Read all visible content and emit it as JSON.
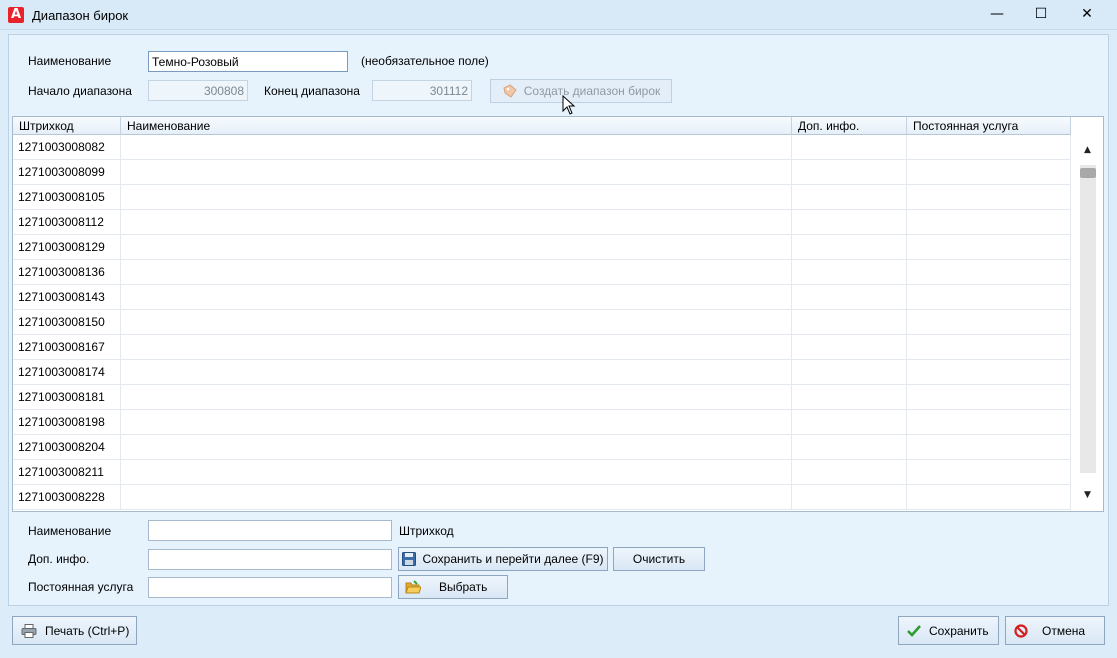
{
  "window": {
    "title": "Диапазон бирок",
    "logo_letter": "A",
    "minimize": "—",
    "maximize": "☐",
    "close": "✕"
  },
  "header_form": {
    "name_label": "Наименование",
    "name_value": "Темно-Розовый",
    "optional_hint": "(необязательное поле)",
    "range_start_label": "Начало диапазона",
    "range_start_value": "300808",
    "range_end_label": "Конец диапазона",
    "range_end_value": "301112",
    "create_range_label": "Создать диапазон бирок"
  },
  "grid": {
    "columns": [
      "Штрихкод",
      "Наименование",
      "Доп. инфо.",
      "Постоянная услуга"
    ],
    "rows": [
      [
        "1271003008082",
        "",
        "",
        ""
      ],
      [
        "1271003008099",
        "",
        "",
        ""
      ],
      [
        "1271003008105",
        "",
        "",
        ""
      ],
      [
        "1271003008112",
        "",
        "",
        ""
      ],
      [
        "1271003008129",
        "",
        "",
        ""
      ],
      [
        "1271003008136",
        "",
        "",
        ""
      ],
      [
        "1271003008143",
        "",
        "",
        ""
      ],
      [
        "1271003008150",
        "",
        "",
        ""
      ],
      [
        "1271003008167",
        "",
        "",
        ""
      ],
      [
        "1271003008174",
        "",
        "",
        ""
      ],
      [
        "1271003008181",
        "",
        "",
        ""
      ],
      [
        "1271003008198",
        "",
        "",
        ""
      ],
      [
        "1271003008204",
        "",
        "",
        ""
      ],
      [
        "1271003008211",
        "",
        "",
        ""
      ],
      [
        "1271003008228",
        "",
        "",
        ""
      ]
    ],
    "scroll_up": "▲",
    "scroll_down": "▼"
  },
  "edit_form": {
    "name_label": "Наименование",
    "name_value": "",
    "barcode_label": "Штрихкод",
    "info_label": "Доп. инфо.",
    "info_value": "",
    "service_label": "Постоянная услуга",
    "service_value": "",
    "save_next_label": "Сохранить и перейти далее (F9)",
    "clear_label": "Очистить",
    "select_label": "Выбрать"
  },
  "footer": {
    "print_label": "Печать (Ctrl+P)",
    "save_label": "Сохранить",
    "cancel_label": "Отмена"
  },
  "colors": {
    "accent": "#e8232b",
    "window_bg": "#dcecf9",
    "panel_bg": "#e6f2fc",
    "ok_green": "#2e9c2e",
    "cancel_red": "#d21f1f"
  }
}
